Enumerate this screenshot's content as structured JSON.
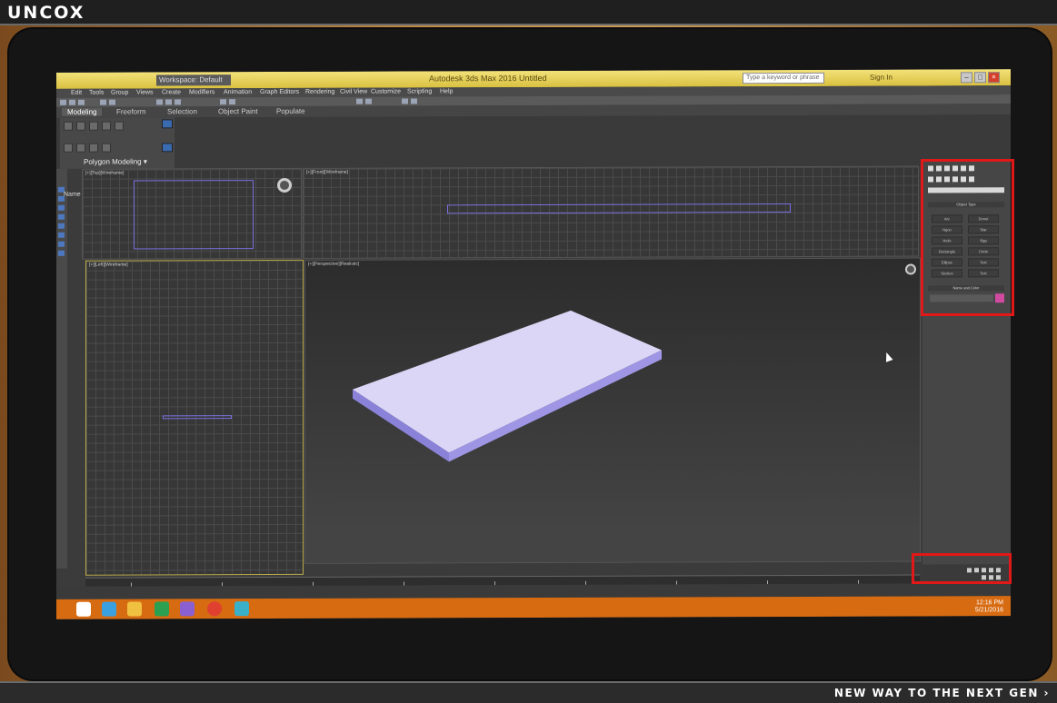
{
  "header": {
    "brand": "UNCOX"
  },
  "footer": {
    "tagline": "NEW WAY TO THE NEXT GEN ›"
  },
  "app": {
    "title": "Autodesk 3ds Max 2016    Untitled",
    "workspace": "Workspace: Default",
    "search_placeholder": "Type a keyword or phrase",
    "sign_in": "Sign In",
    "menu": [
      "Edit",
      "Tools",
      "Group",
      "Views",
      "Create",
      "Modifiers",
      "Animation",
      "Graph Editors",
      "Rendering",
      "Civil View",
      "Customize",
      "Scripting",
      "Help"
    ],
    "ribbon_tabs": [
      "Modeling",
      "Freeform",
      "Selection",
      "Object Paint",
      "Populate"
    ],
    "ribbon_group_label": "Polygon Modeling ▾",
    "scene_explorer_label": "Name"
  },
  "viewports": {
    "top": "[+][Top][Wireframe]",
    "front": "[+][Front][Wireframe]",
    "left": "[+][Left][Wireframe]",
    "perspective": "[+][Perspective][Realistic]"
  },
  "command_panel": {
    "object_type_header": "Object Type",
    "buttons": [
      "Arc",
      "Donut",
      "Ngon",
      "Star",
      "Helix",
      "Egg",
      "Rectangle",
      "Circle",
      "Ellipse",
      "Text",
      "Section",
      "Text"
    ],
    "name_color_header": "Name and Color",
    "object_color": "#d04aa0"
  },
  "taskbar": {
    "time": "12:16 PM",
    "date": "5/21/2016"
  },
  "colors": {
    "accent_highlight": "#e01818",
    "taskbar": "#d66b12",
    "titlebar": "#e5d05a"
  }
}
